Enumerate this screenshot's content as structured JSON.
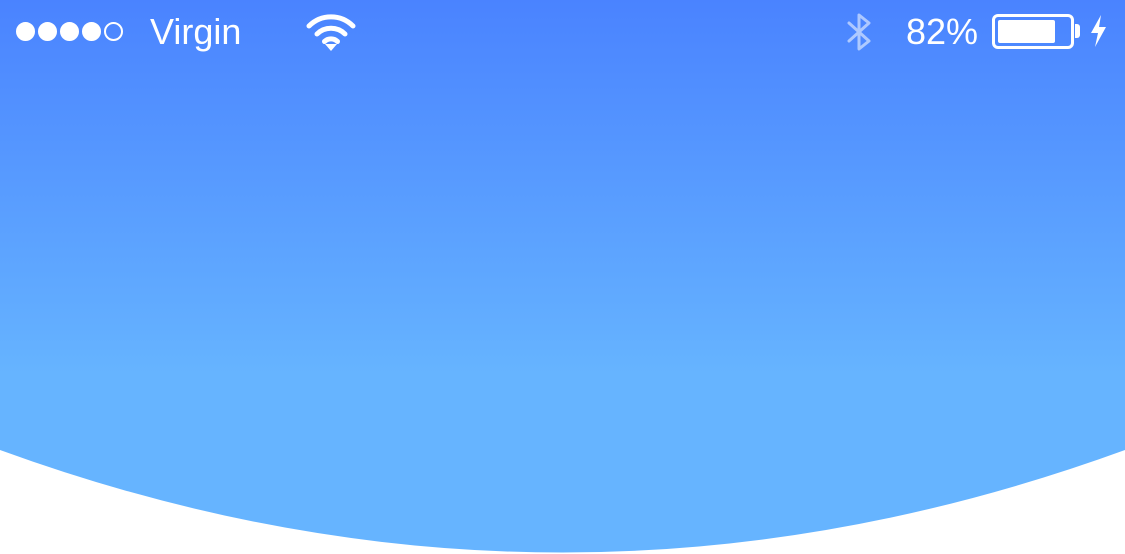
{
  "status_bar": {
    "signal_strength": 4,
    "signal_max": 5,
    "carrier": "Virgin",
    "wifi_icon": "wifi-icon",
    "bluetooth_icon": "bluetooth-icon",
    "battery_percent_label": "82%",
    "battery_level": 0.82,
    "charging_icon": "charging-bolt-icon"
  },
  "colors": {
    "header_gradient_top": "#4a83ff",
    "header_gradient_bottom": "#66b4ff",
    "background": "#ffffff",
    "status_text": "#ffffff"
  }
}
